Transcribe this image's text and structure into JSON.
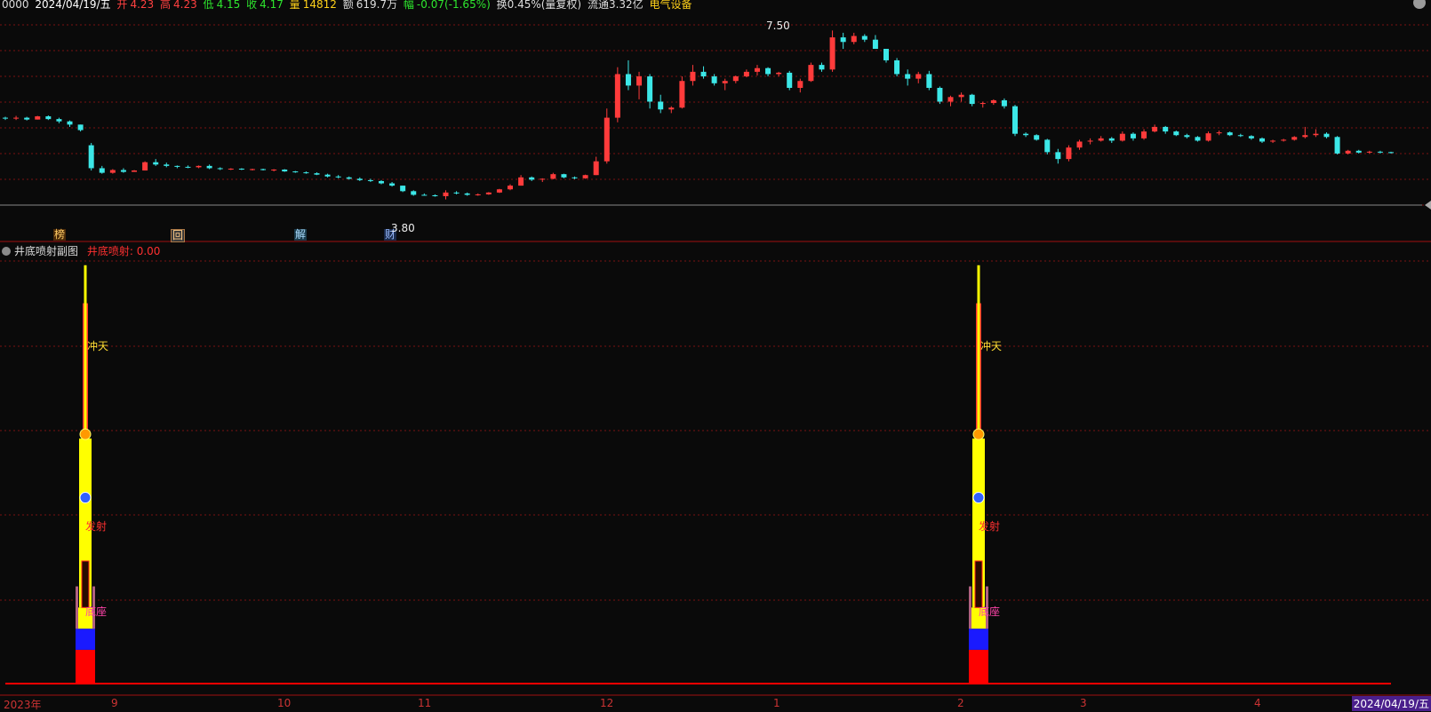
{
  "header": {
    "stock": "0000",
    "date": "2024/04/19/五",
    "open_label": "开",
    "open": "4.23",
    "high_label": "高",
    "high": "4.23",
    "low_label": "低",
    "low": "4.15",
    "close_label": "收",
    "close": "4.17",
    "vol_label": "量",
    "vol": "14812",
    "amt_label": "额",
    "amt": "619.7万",
    "chg_label": "幅",
    "chg": "-0.07(-1.65%)",
    "turnover": "换0.45%(量复权)",
    "float": "流通3.32亿",
    "sector": "电气设备"
  },
  "colors": {
    "up": "#ff3b3b",
    "down": "#3ce7e7",
    "bg": "#0a0a0a",
    "grid": "#7a1212",
    "yellow": "#ffff00",
    "blue": "#1a1aff"
  },
  "markers": [
    "榜",
    "回",
    "解",
    "财"
  ],
  "annotations": {
    "high": "7.50",
    "low": "3.80"
  },
  "indicator": {
    "title": "井底喷射副图",
    "value_label": "井底喷射: 0.00",
    "labels": [
      "冲天",
      "发射",
      "底座"
    ]
  },
  "x_labels": [
    "2023年",
    "9",
    "10",
    "11",
    "12",
    "1",
    "2",
    "3",
    "4"
  ],
  "x_end_label": "2024/04/19/五",
  "chart_data": [
    {
      "type": "candlestick",
      "title": "",
      "ylim": [
        3.6,
        7.7
      ],
      "candles": [
        [
          5.6,
          5.62,
          5.55,
          5.58
        ],
        [
          5.58,
          5.64,
          5.55,
          5.6
        ],
        [
          5.6,
          5.62,
          5.54,
          5.56
        ],
        [
          5.56,
          5.64,
          5.56,
          5.63
        ],
        [
          5.63,
          5.65,
          5.55,
          5.57
        ],
        [
          5.57,
          5.6,
          5.48,
          5.52
        ],
        [
          5.52,
          5.54,
          5.4,
          5.45
        ],
        [
          5.45,
          5.45,
          5.3,
          5.33
        ],
        [
          5.0,
          5.05,
          4.45,
          4.5
        ],
        [
          4.5,
          4.55,
          4.38,
          4.4
        ],
        [
          4.4,
          4.48,
          4.38,
          4.46
        ],
        [
          4.46,
          4.5,
          4.4,
          4.42
        ],
        [
          4.42,
          4.46,
          4.42,
          4.45
        ],
        [
          4.45,
          4.65,
          4.45,
          4.63
        ],
        [
          4.63,
          4.7,
          4.55,
          4.58
        ],
        [
          4.58,
          4.62,
          4.52,
          4.55
        ],
        [
          4.55,
          4.56,
          4.5,
          4.53
        ],
        [
          4.53,
          4.56,
          4.5,
          4.52
        ],
        [
          4.52,
          4.56,
          4.5,
          4.55
        ],
        [
          4.55,
          4.58,
          4.48,
          4.5
        ],
        [
          4.5,
          4.52,
          4.46,
          4.48
        ],
        [
          4.48,
          4.5,
          4.46,
          4.49
        ],
        [
          4.49,
          4.5,
          4.46,
          4.47
        ],
        [
          4.47,
          4.49,
          4.45,
          4.48
        ],
        [
          4.48,
          4.49,
          4.45,
          4.46
        ],
        [
          4.46,
          4.48,
          4.43,
          4.47
        ],
        [
          4.47,
          4.48,
          4.42,
          4.43
        ],
        [
          4.43,
          4.44,
          4.4,
          4.41
        ],
        [
          4.41,
          4.43,
          4.38,
          4.39
        ],
        [
          4.39,
          4.41,
          4.35,
          4.36
        ],
        [
          4.36,
          4.38,
          4.3,
          4.32
        ],
        [
          4.32,
          4.35,
          4.28,
          4.3
        ],
        [
          4.3,
          4.32,
          4.25,
          4.27
        ],
        [
          4.27,
          4.3,
          4.22,
          4.24
        ],
        [
          4.24,
          4.27,
          4.2,
          4.22
        ],
        [
          4.22,
          4.24,
          4.15,
          4.17
        ],
        [
          4.17,
          4.2,
          4.1,
          4.12
        ],
        [
          4.12,
          4.12,
          3.98,
          4.0
        ],
        [
          4.0,
          4.02,
          3.9,
          3.92
        ],
        [
          3.92,
          3.95,
          3.9,
          3.91
        ],
        [
          3.91,
          3.93,
          3.88,
          3.89
        ],
        [
          3.89,
          4.02,
          3.82,
          3.97
        ],
        [
          3.97,
          4.0,
          3.93,
          3.95
        ],
        [
          3.95,
          3.97,
          3.9,
          3.92
        ],
        [
          3.92,
          3.95,
          3.9,
          3.93
        ],
        [
          3.93,
          3.98,
          3.92,
          3.97
        ],
        [
          3.97,
          4.05,
          3.96,
          4.04
        ],
        [
          4.04,
          4.15,
          4.02,
          4.12
        ],
        [
          4.12,
          4.35,
          4.12,
          4.3
        ],
        [
          4.3,
          4.32,
          4.22,
          4.25
        ],
        [
          4.25,
          4.28,
          4.2,
          4.27
        ],
        [
          4.27,
          4.4,
          4.26,
          4.37
        ],
        [
          4.37,
          4.38,
          4.28,
          4.3
        ],
        [
          4.3,
          4.32,
          4.26,
          4.28
        ],
        [
          4.28,
          4.36,
          4.27,
          4.35
        ],
        [
          4.35,
          4.75,
          4.35,
          4.65
        ],
        [
          4.65,
          5.8,
          4.6,
          5.6
        ],
        [
          5.6,
          6.7,
          5.5,
          6.55
        ],
        [
          6.55,
          6.85,
          6.2,
          6.3
        ],
        [
          6.3,
          6.6,
          6.0,
          6.5
        ],
        [
          6.5,
          6.55,
          5.8,
          5.95
        ],
        [
          5.95,
          6.1,
          5.7,
          5.78
        ],
        [
          5.78,
          5.85,
          5.7,
          5.82
        ],
        [
          5.82,
          6.5,
          5.8,
          6.4
        ],
        [
          6.4,
          6.75,
          6.3,
          6.6
        ],
        [
          6.6,
          6.72,
          6.45,
          6.5
        ],
        [
          6.5,
          6.55,
          6.3,
          6.35
        ],
        [
          6.35,
          6.45,
          6.2,
          6.4
        ],
        [
          6.4,
          6.52,
          6.35,
          6.5
        ],
        [
          6.5,
          6.65,
          6.48,
          6.6
        ],
        [
          6.6,
          6.75,
          6.52,
          6.68
        ],
        [
          6.68,
          6.7,
          6.5,
          6.55
        ],
        [
          6.55,
          6.6,
          6.5,
          6.58
        ],
        [
          6.58,
          6.62,
          6.2,
          6.25
        ],
        [
          6.25,
          6.45,
          6.15,
          6.4
        ],
        [
          6.4,
          6.8,
          6.38,
          6.75
        ],
        [
          6.75,
          6.8,
          6.6,
          6.65
        ],
        [
          6.65,
          7.5,
          6.6,
          7.35
        ],
        [
          7.35,
          7.45,
          7.1,
          7.25
        ],
        [
          7.25,
          7.45,
          7.2,
          7.38
        ],
        [
          7.38,
          7.42,
          7.25,
          7.3
        ],
        [
          7.3,
          7.4,
          7.2,
          7.1
        ],
        [
          7.1,
          7.1,
          6.8,
          6.85
        ],
        [
          6.85,
          6.9,
          6.5,
          6.55
        ],
        [
          6.55,
          6.65,
          6.3,
          6.45
        ],
        [
          6.45,
          6.6,
          6.35,
          6.55
        ],
        [
          6.55,
          6.62,
          6.2,
          6.25
        ],
        [
          6.25,
          6.28,
          5.9,
          5.95
        ],
        [
          5.95,
          6.08,
          5.85,
          6.05
        ],
        [
          6.05,
          6.15,
          5.95,
          6.1
        ],
        [
          6.1,
          6.12,
          5.85,
          5.9
        ],
        [
          5.9,
          5.95,
          5.82,
          5.92
        ],
        [
          5.92,
          6.0,
          5.88,
          5.98
        ],
        [
          5.98,
          6.02,
          5.8,
          5.85
        ],
        [
          5.85,
          5.88,
          5.2,
          5.25
        ],
        [
          5.25,
          5.28,
          5.18,
          5.22
        ],
        [
          5.22,
          5.24,
          5.1,
          5.12
        ],
        [
          5.12,
          5.14,
          4.8,
          4.85
        ],
        [
          4.85,
          4.92,
          4.6,
          4.7
        ],
        [
          4.7,
          5.0,
          4.65,
          4.95
        ],
        [
          4.95,
          5.12,
          4.9,
          5.08
        ],
        [
          5.08,
          5.15,
          5.02,
          5.1
        ],
        [
          5.1,
          5.2,
          5.08,
          5.15
        ],
        [
          5.15,
          5.18,
          5.05,
          5.1
        ],
        [
          5.1,
          5.3,
          5.08,
          5.25
        ],
        [
          5.25,
          5.28,
          5.1,
          5.15
        ],
        [
          5.15,
          5.35,
          5.12,
          5.3
        ],
        [
          5.3,
          5.45,
          5.28,
          5.4
        ],
        [
          5.4,
          5.42,
          5.25,
          5.3
        ],
        [
          5.3,
          5.32,
          5.2,
          5.22
        ],
        [
          5.22,
          5.25,
          5.15,
          5.18
        ],
        [
          5.18,
          5.2,
          5.08,
          5.1
        ],
        [
          5.1,
          5.3,
          5.08,
          5.26
        ],
        [
          5.26,
          5.32,
          5.22,
          5.28
        ],
        [
          5.28,
          5.3,
          5.2,
          5.22
        ],
        [
          5.22,
          5.25,
          5.18,
          5.2
        ],
        [
          5.2,
          5.22,
          5.12,
          5.15
        ],
        [
          5.15,
          5.17,
          5.05,
          5.08
        ],
        [
          5.08,
          5.12,
          5.05,
          5.1
        ],
        [
          5.1,
          5.14,
          5.08,
          5.12
        ],
        [
          5.12,
          5.2,
          5.1,
          5.18
        ],
        [
          5.18,
          5.4,
          5.15,
          5.22
        ],
        [
          5.22,
          5.35,
          5.18,
          5.25
        ],
        [
          5.25,
          5.28,
          5.15,
          5.18
        ],
        [
          5.18,
          5.2,
          4.8,
          4.82
        ],
        [
          4.82,
          4.9,
          4.8,
          4.88
        ],
        [
          4.88,
          4.9,
          4.82,
          4.84
        ],
        [
          4.84,
          4.88,
          4.82,
          4.86
        ],
        [
          4.86,
          4.88,
          4.82,
          4.85
        ],
        [
          4.85,
          4.86,
          4.82,
          4.83
        ]
      ]
    },
    {
      "type": "bar",
      "title": "井底喷射副图",
      "ylim": [
        0,
        100
      ],
      "values": [
        0.0
      ]
    }
  ]
}
